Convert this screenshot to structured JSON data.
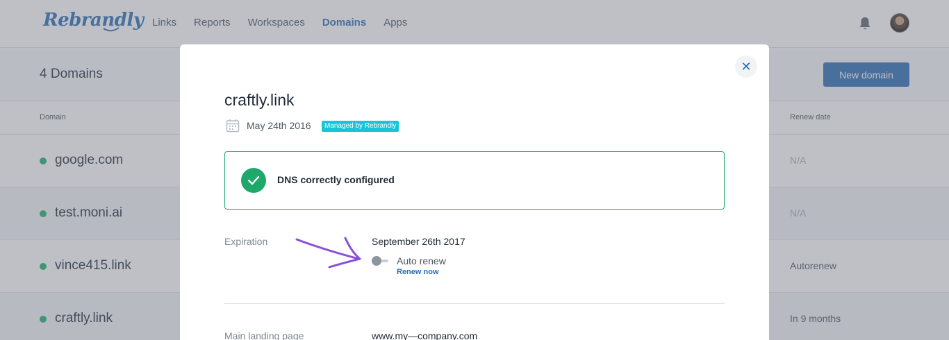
{
  "app": {
    "logo_text": "Rebrandly",
    "nav": [
      "Links",
      "Reports",
      "Workspaces",
      "Domains",
      "Apps"
    ],
    "nav_active": "Domains",
    "icons": {
      "bell": "bell-icon",
      "avatar": "user-avatar"
    }
  },
  "domains_page": {
    "count_label": "4 Domains",
    "new_domain_label": "New domain",
    "columns": {
      "domain": "Domain",
      "renew_date": "Renew date"
    },
    "rows": [
      {
        "name": "google.com",
        "renew": "N/A"
      },
      {
        "name": "test.moni.ai",
        "renew": "N/A"
      },
      {
        "name": "vince415.link",
        "renew": "Autorenew"
      },
      {
        "name": "craftly.link",
        "renew": "In 9 months"
      }
    ],
    "status_color": "#1bb26b"
  },
  "modal": {
    "title": "craftly.link",
    "date": "May 24th 2016",
    "badge": "Managed by Rebrandly",
    "dns_status": "DNS correctly configured",
    "expiration_label": "Expiration",
    "expiration_date": "September 26th 2017",
    "auto_renew_label": "Auto renew",
    "auto_renew_enabled": false,
    "renew_now_label": "Renew now",
    "landing_label": "Main landing page",
    "landing_value": "www.my—company.com",
    "close_icon": "close-icon"
  },
  "colors": {
    "brand": "#2a6cb3",
    "success": "#1ea86a",
    "badge": "#17c4d8",
    "annotation_arrow": "#8a4fd8"
  }
}
